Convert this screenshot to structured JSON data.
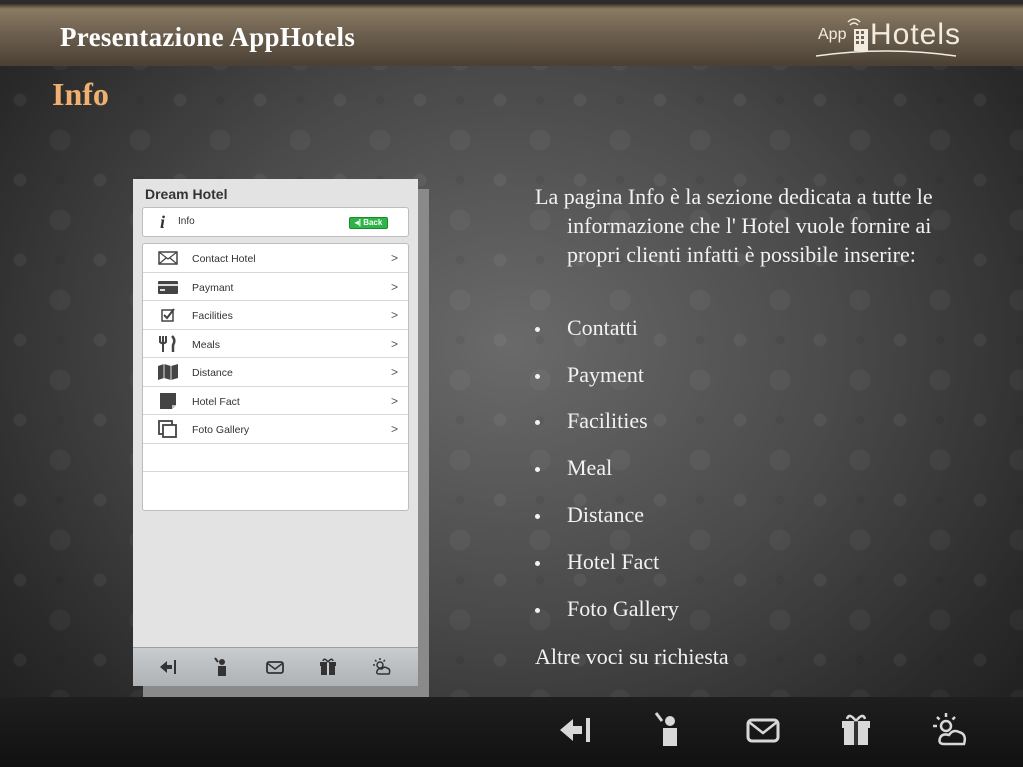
{
  "header": {
    "title": "Presentazione AppHotels",
    "logo": {
      "prefix": "App",
      "name": "Hotels"
    }
  },
  "section_title": "Info",
  "phone": {
    "hotel_name": "Dream Hotel",
    "info_label": "Info",
    "back_label": "Back",
    "menu": [
      {
        "label": "Contact Hotel",
        "icon": "envelope-icon"
      },
      {
        "label": "Paymant",
        "icon": "credit-card-icon"
      },
      {
        "label": "Facilities",
        "icon": "checkbox-icon"
      },
      {
        "label": "Meals",
        "icon": "fork-knife-icon"
      },
      {
        "label": "Distance",
        "icon": "map-icon"
      },
      {
        "label": "Hotel Fact",
        "icon": "note-icon"
      },
      {
        "label": "Foto Gallery",
        "icon": "gallery-icon"
      }
    ],
    "tabbar": [
      "back-exit-icon",
      "bellboy-icon",
      "mail-icon",
      "gift-icon",
      "weather-icon"
    ]
  },
  "description": {
    "intro": "La pagina Info è la sezione dedicata a tutte le informazione che l' Hotel vuole fornire ai propri clienti infatti è possibile inserire:",
    "items": [
      "Contatti",
      "Payment",
      "Facilities",
      "Meal",
      "Distance",
      "Hotel Fact",
      "Foto Gallery"
    ],
    "outro": "Altre voci su richiesta"
  },
  "bottombar": [
    "back-exit-icon",
    "bellboy-icon",
    "mail-icon",
    "gift-icon",
    "weather-icon"
  ],
  "colors": {
    "section_title": "#f0b070",
    "back_button": "#2db548",
    "text": "#f2f2f2"
  }
}
